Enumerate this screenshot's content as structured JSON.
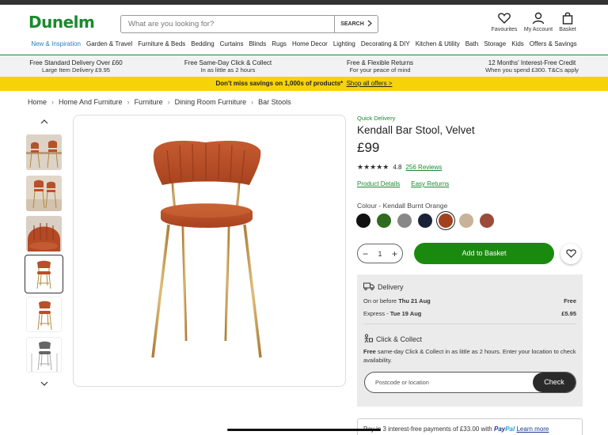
{
  "header": {
    "logo": "Dunelm",
    "search_placeholder": "What are you looking for?",
    "search_button": "SEARCH",
    "favourites": "Favourites",
    "account": "My Account",
    "basket": "Basket"
  },
  "nav": [
    "New & Inspiration",
    "Garden & Travel",
    "Furniture & Beds",
    "Bedding",
    "Curtains",
    "Blinds",
    "Rugs",
    "Home Decor",
    "Lighting",
    "Decorating & DIY",
    "Kitchen & Utility",
    "Bath",
    "Storage",
    "Kids",
    "Offers & Savings"
  ],
  "usps": [
    {
      "title": "Free Standard Delivery Over £60",
      "sub": "Large Item Delivery £9.95"
    },
    {
      "title": "Free Same-Day Click & Collect",
      "sub": "In as little as 2 hours"
    },
    {
      "title": "Free & Flexible Returns",
      "sub": "For your peace of mind"
    },
    {
      "title": "12 Months' Interest-Free Credit",
      "sub": "When you spend £300. T&Cs apply"
    }
  ],
  "promo": {
    "text": "Don't miss savings on 1,000s of products*",
    "link": "Shop all offers >"
  },
  "breadcrumb": [
    "Home",
    "Home And Furniture",
    "Furniture",
    "Dining Room Furniture",
    "Bar Stools"
  ],
  "product": {
    "badge": "Quick Delivery",
    "title": "Kendall Bar Stool, Velvet",
    "price": "£99",
    "rating": "4.8",
    "reviews": "256 Reviews",
    "details_link": "Product Details",
    "returns_link": "Easy Returns",
    "colour_label": "Colour - Kendall Burnt Orange",
    "swatches": [
      "#111111",
      "#2e6b1f",
      "#888888",
      "#1a2238",
      "#a3401e",
      "#c8b29a",
      "#9a4b3a"
    ],
    "quantity": "1",
    "add_button": "Add to Basket"
  },
  "delivery": {
    "title": "Delivery",
    "rows": [
      {
        "label_pre": "On or before ",
        "label_bold": "Thu 21 Aug",
        "value": "Free"
      },
      {
        "label_pre": "Express - ",
        "label_bold": "Tue 19 Aug",
        "value": "£5.95"
      }
    ],
    "cc_title": "Click & Collect",
    "cc_bold": "Free",
    "cc_text": " same-day Click & Collect in as little as 2 hours. Enter your location to check availability.",
    "postcode_placeholder": "Postcode or location",
    "check_button": "Check"
  },
  "paypal": {
    "pre": "Pay in 3 interest-free payments of £33.00 with ",
    "brand1": "Pay",
    "brand2": "Pal",
    "link": "Learn more"
  }
}
